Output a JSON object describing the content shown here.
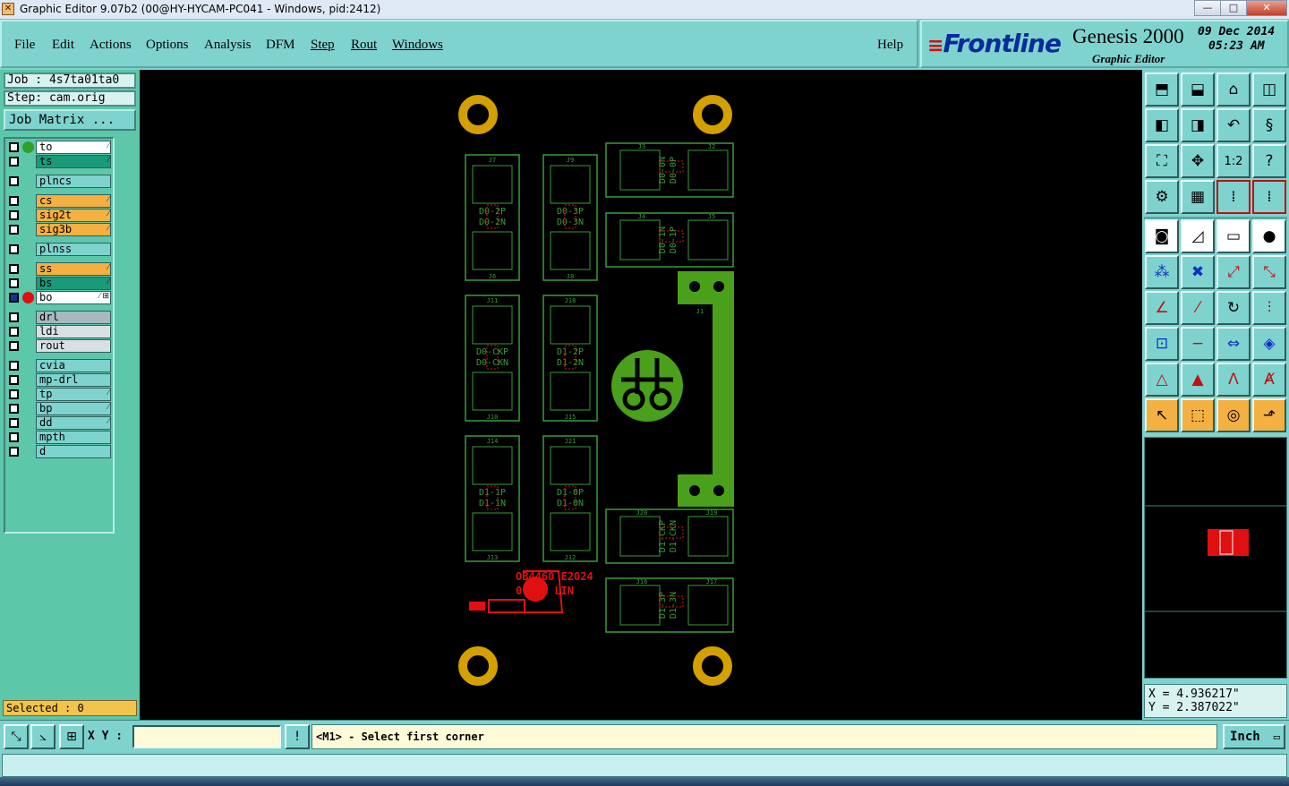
{
  "window": {
    "title": "Graphic Editor 9.07b2 (00@HY-HYCAM-PC041 - Windows, pid:2412)",
    "minimize": "—",
    "maximize": "□",
    "close": "✕"
  },
  "menu": {
    "file": "File",
    "edit": "Edit",
    "actions": "Actions",
    "options": "Options",
    "analysis": "Analysis",
    "dfm": "DFM",
    "step": "Step",
    "rout": "Rout",
    "windows": "Windows",
    "help": "Help"
  },
  "brand": {
    "logo": "Frontline",
    "product": "Genesis 2000",
    "subtitle": "Graphic Editor",
    "date": "09 Dec 2014",
    "time": "05:23 AM"
  },
  "job": {
    "job_label": "Job : 4s7ta01ta0",
    "step_label": "Step: cam.orig",
    "matrix_button": "Job Matrix ..."
  },
  "layers": [
    {
      "name": "to",
      "color": "#ffffff",
      "dot": "#2fa02f",
      "flag": "⁄"
    },
    {
      "name": "ts",
      "color": "#1a9a78",
      "dot": "",
      "flag": "⁄"
    },
    {
      "name": "plncs",
      "color": "#7fd3cf",
      "dot": "",
      "flag": ""
    },
    {
      "name": "cs",
      "color": "#f4b040",
      "dot": "",
      "flag": "⁄"
    },
    {
      "name": "sig2t",
      "color": "#f4b040",
      "dot": "",
      "flag": "⁄"
    },
    {
      "name": "sig3b",
      "color": "#f4b040",
      "dot": "",
      "flag": "⁄"
    },
    {
      "name": "plnss",
      "color": "#7fd3cf",
      "dot": "",
      "flag": ""
    },
    {
      "name": "ss",
      "color": "#f4b040",
      "dot": "",
      "flag": "⁄"
    },
    {
      "name": "bs",
      "color": "#1a9a78",
      "dot": "",
      "flag": "⁄"
    },
    {
      "name": "bo",
      "color": "#ffffff",
      "dot": "#e01010",
      "flag": "⁄ ⊞"
    },
    {
      "name": "drl",
      "color": "#a8b8c0",
      "dot": "",
      "flag": ""
    },
    {
      "name": "ldi",
      "color": "#d8e0e4",
      "dot": "",
      "flag": ""
    },
    {
      "name": "rout",
      "color": "#d8e0e4",
      "dot": "",
      "flag": ""
    },
    {
      "name": "cvia",
      "color": "#7fd3cf",
      "dot": "",
      "flag": ""
    },
    {
      "name": "mp-drl",
      "color": "#7fd3cf",
      "dot": "",
      "flag": ""
    },
    {
      "name": "tp",
      "color": "#7fd3cf",
      "dot": "",
      "flag": "⁄"
    },
    {
      "name": "bp",
      "color": "#7fd3cf",
      "dot": "",
      "flag": "⁄"
    },
    {
      "name": "dd",
      "color": "#7fd3cf",
      "dot": "",
      "flag": "⁄"
    },
    {
      "name": "mpth",
      "color": "#7fd3cf",
      "dot": "",
      "flag": ""
    },
    {
      "name": "d",
      "color": "#7fd3cf",
      "dot": "",
      "flag": ""
    }
  ],
  "selected": "Selected : 0",
  "coords": {
    "x": "X = 4.936217\"",
    "y": "Y = 2.387022\""
  },
  "bottom": {
    "xy_label": "X Y :",
    "xy_value": "",
    "alert": "!",
    "message": "<M1> - Select first corner",
    "units": "Inch"
  },
  "pcb": {
    "connectors": [
      {
        "top": "J7",
        "bottom": "J6",
        "labels": [
          "D0-2P",
          "D0-2N"
        ]
      },
      {
        "top": "J9",
        "bottom": "J8",
        "labels": [
          "D0-3P",
          "D0-3N"
        ]
      },
      {
        "top": "J11",
        "bottom": "J10",
        "labels": [
          "D0-CKP",
          "D0-CKN"
        ]
      },
      {
        "top": "J18",
        "bottom": "J15",
        "labels": [
          "D1-2P",
          "D1-2N"
        ]
      },
      {
        "top": "J14",
        "bottom": "J13",
        "labels": [
          "D1-1P",
          "D1-1N"
        ]
      },
      {
        "top": "J21",
        "bottom": "J12",
        "labels": [
          "D1-0P",
          "D1-0N"
        ]
      }
    ],
    "side_connectors": [
      {
        "left": "J3",
        "right": "J2",
        "labels": [
          "D0-0N",
          "D0-0P"
        ]
      },
      {
        "left": "J4",
        "right": "J5",
        "labels": [
          "D0-1N",
          "D0-1P"
        ]
      },
      {
        "left": "J20",
        "right": "J19",
        "labels": [
          "D1-CKP",
          "D1-CKN"
        ]
      },
      {
        "left": "J16",
        "right": "J17",
        "labels": [
          "D1-3P",
          "D1-3N"
        ]
      }
    ],
    "edge_connector_ref": "J1",
    "marking_line1": "OB4460 E2024",
    "marking_line2": "0-V94 LIN"
  }
}
